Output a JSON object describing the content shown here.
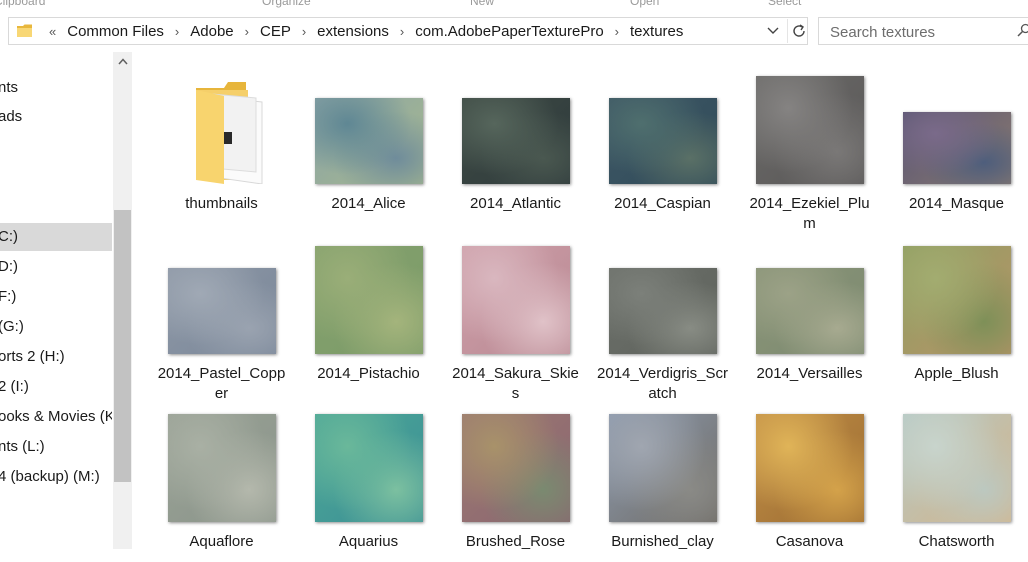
{
  "ribbon": {
    "labels": [
      "Clipboard",
      "Organize",
      "New",
      "Open",
      "Select"
    ]
  },
  "address_bar": {
    "overflow": "«",
    "crumbs": [
      "Common Files",
      "Adobe",
      "CEP",
      "extensions",
      "com.AdobePaperTexturePro",
      "textures"
    ],
    "separator": "›",
    "dropdown_icon": "chevron-down-icon",
    "refresh_icon": "refresh-icon"
  },
  "search": {
    "placeholder": "Search textures",
    "icon": "search-icon"
  },
  "nav_pane": {
    "items": [
      {
        "label": "nts",
        "selected": false
      },
      {
        "label": "ads",
        "selected": false
      },
      {
        "label": "C:)",
        "selected": true
      },
      {
        "label": "D:)",
        "selected": false
      },
      {
        "label": "F:)",
        "selected": false
      },
      {
        "label": "(G:)",
        "selected": false
      },
      {
        "label": "orts 2 (H:)",
        "selected": false
      },
      {
        "label": "2 (I:)",
        "selected": false
      },
      {
        "label": "ooks & Movies (K",
        "selected": false
      },
      {
        "label": "nts (L:)",
        "selected": false
      },
      {
        "label": "4 (backup) (M:)",
        "selected": false
      }
    ]
  },
  "files": [
    {
      "name": "thumbnails",
      "type": "folder"
    },
    {
      "name": "2014_Alice",
      "colors": [
        "#8aa3a6",
        "#5f8794",
        "#a7b98e",
        "#6f8c9b"
      ]
    },
    {
      "name": "2014_Atlantic",
      "colors": [
        "#3e4a44",
        "#56665c",
        "#2e3a3c",
        "#4a5850"
      ]
    },
    {
      "name": "2014_Caspian",
      "colors": [
        "#3f5866",
        "#4f6f6e",
        "#2f4a58",
        "#5a7066"
      ]
    },
    {
      "name": "2014_Ezekiel_Plum",
      "colors": [
        "#6c6b69",
        "#858382",
        "#585656",
        "#7a7877"
      ]
    },
    {
      "name": "2014_Masque",
      "colors": [
        "#5a5673",
        "#7a6a8a",
        "#8a7a70",
        "#4e5e7c"
      ]
    },
    {
      "name": "2014_Pastel_Copper",
      "colors": [
        "#8e98a6",
        "#a0a9b5",
        "#7a8799",
        "#9aa3b0"
      ]
    },
    {
      "name": "2014_Pistachio",
      "colors": [
        "#86a26e",
        "#9aae78",
        "#7a9a68",
        "#a4b47c"
      ]
    },
    {
      "name": "2014_Sakura_Skies",
      "colors": [
        "#cfa0aa",
        "#d9b7bf",
        "#b88892",
        "#e0c2c8"
      ]
    },
    {
      "name": "2014_Verdigris_Scratch",
      "colors": [
        "#6c706a",
        "#7c807a",
        "#5e625c",
        "#888c84"
      ]
    },
    {
      "name": "2014_Versailles",
      "colors": [
        "#8a9478",
        "#9ca287",
        "#7c8a70",
        "#a7aa90"
      ]
    },
    {
      "name": "Apple_Blush",
      "colors": [
        "#8f9e62",
        "#a2ac70",
        "#b89468",
        "#7e9058"
      ]
    },
    {
      "name": "Aquaflore",
      "colors": [
        "#9aa296",
        "#a9b0a4",
        "#8a948a",
        "#b4b8ac"
      ]
    },
    {
      "name": "Aquarius",
      "colors": [
        "#4ea898",
        "#6ab89a",
        "#3a8e94",
        "#7cc0a0"
      ]
    },
    {
      "name": "Brushed_Rose",
      "colors": [
        "#9c7a72",
        "#a8926a",
        "#8a6470",
        "#7a8a70"
      ]
    },
    {
      "name": "Burnished_clay",
      "colors": [
        "#8e9cb0",
        "#a0a6b0",
        "#6e6a64",
        "#8a8a86"
      ]
    },
    {
      "name": "Casanova",
      "colors": [
        "#c29048",
        "#e0b458",
        "#9a6a30",
        "#d4a24a"
      ]
    },
    {
      "name": "Chatsworth",
      "colors": [
        "#b4c8c4",
        "#c8d4cc",
        "#d4b48a",
        "#bcc8c0"
      ]
    }
  ]
}
